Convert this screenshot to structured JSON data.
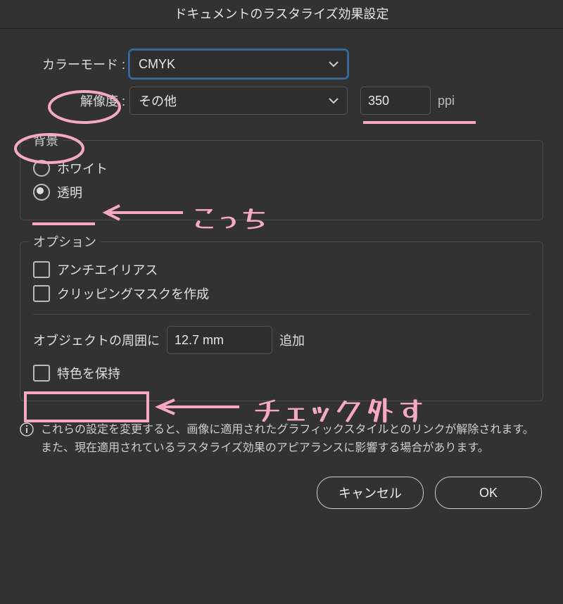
{
  "title": "ドキュメントのラスタライズ効果設定",
  "color_mode": {
    "label": "カラーモード :",
    "value": "CMYK"
  },
  "resolution": {
    "label": "解像度 :",
    "preset": "その他",
    "value": "350",
    "unit": "ppi"
  },
  "background": {
    "legend": "背景",
    "white": "ホワイト",
    "transparent": "透明"
  },
  "options": {
    "legend": "オプション",
    "antialias": "アンチエイリアス",
    "clipping_mask": "クリッピングマスクを作成",
    "padding_prefix": "オブジェクトの周囲に",
    "padding_value": "12.7 mm",
    "padding_suffix": "追加",
    "preserve_spot": "特色を保持"
  },
  "info": "これらの設定を変更すると、画像に適用されたグラフィックスタイルとのリンクが解除されます。また、現在適用されているラスタライズ効果のアピアランスに影響する場合があります。",
  "buttons": {
    "cancel": "キャンセル",
    "ok": "OK"
  },
  "annotations": {
    "kocchi": "こっち",
    "checkoff": "チェック外す",
    "pink": "#f7a8c4"
  }
}
